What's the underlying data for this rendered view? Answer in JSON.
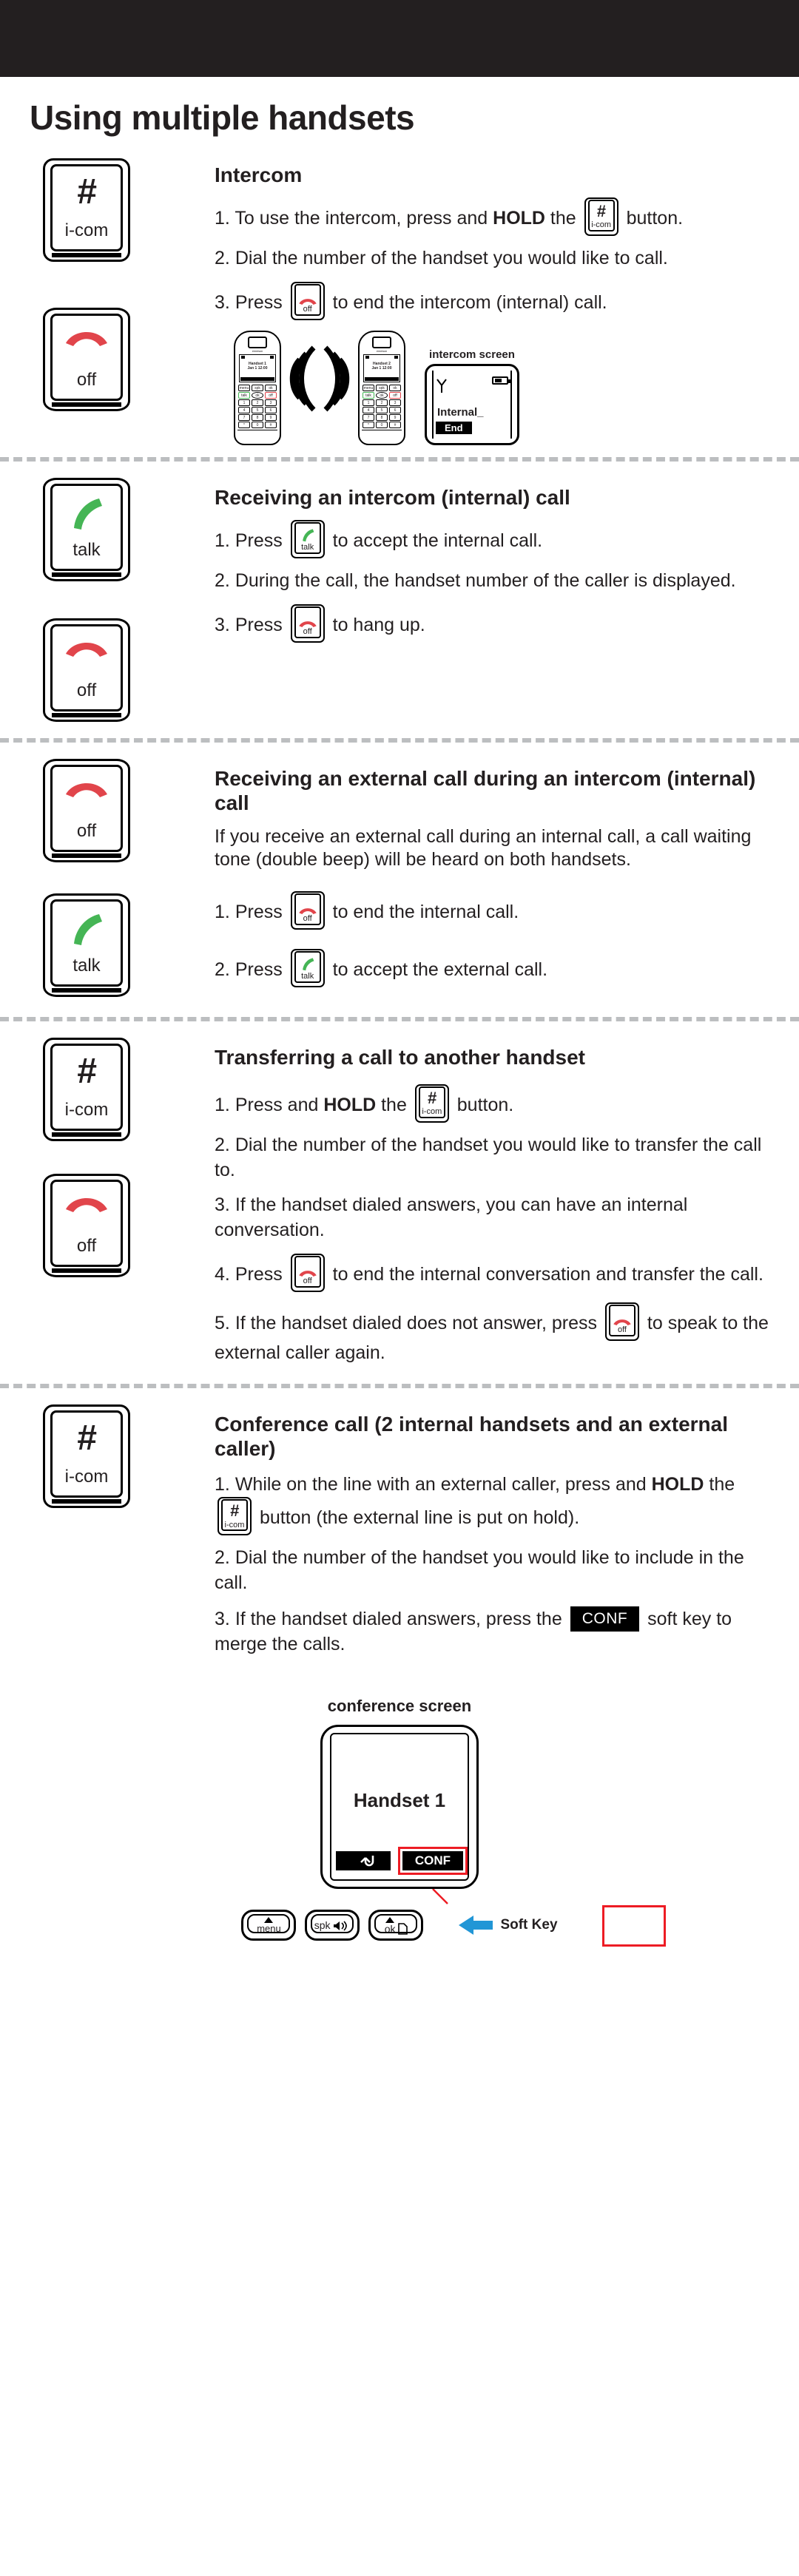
{
  "page_title": "Using multiple handsets",
  "keys": {
    "icom": {
      "glyph": "#",
      "label": "i-com",
      "name": "i-com-key"
    },
    "off": {
      "glyph": "",
      "label": "off",
      "name": "off-key"
    },
    "talk": {
      "glyph": "",
      "label": "talk",
      "name": "talk-key"
    }
  },
  "colors": {
    "header_bar": "#231f20",
    "off_hook_red": "#e1454b",
    "talk_green": "#45b555",
    "divider_grey": "#bcbec0",
    "highlight_red": "#ed1c24",
    "arrow_blue": "#2196d6",
    "text": "#231f20"
  },
  "sections": [
    {
      "id": "intercom",
      "title": "Intercom",
      "gutter_keys": [
        "icom",
        "off"
      ],
      "steps": [
        {
          "num": "1.",
          "parts": [
            {
              "t": "text",
              "v": "To use the intercom, press and "
            },
            {
              "t": "bold",
              "v": "HOLD"
            },
            {
              "t": "text",
              "v": " the "
            },
            {
              "t": "key",
              "v": "icom"
            },
            {
              "t": "text",
              "v": " button."
            }
          ]
        },
        {
          "num": "2.",
          "parts": [
            {
              "t": "text",
              "v": "Dial the number of the handset you would like to call."
            }
          ]
        },
        {
          "num": "3.",
          "parts": [
            {
              "t": "text",
              "v": "Press "
            },
            {
              "t": "key",
              "v": "off"
            },
            {
              "t": "text",
              "v": " to end the intercom (internal) call."
            }
          ]
        }
      ],
      "illustration": {
        "handsets": [
          {
            "line1": "Handset 1",
            "line2": "Jan 1 12:00",
            "keys": [
              "1",
              "2",
              "3",
              "4",
              "5",
              "6",
              "7",
              "8",
              "9",
              "*",
              "0",
              "#"
            ],
            "soft": [
              "menu",
              "spk",
              "ok"
            ]
          },
          {
            "line1": "Handset 2",
            "line2": "Jan 1 12:00",
            "keys": [
              "1",
              "2",
              "3",
              "4",
              "5",
              "6",
              "7",
              "8",
              "9",
              "*",
              "0",
              "#"
            ],
            "soft": [
              "menu",
              "spk",
              "ok"
            ]
          }
        ],
        "screen_caption": "intercom screen",
        "screen_text": "Internal_",
        "screen_softkey": "End"
      }
    },
    {
      "id": "receiving-intercom",
      "title": "Receiving an intercom (internal) call",
      "gutter_keys": [
        "talk",
        "off"
      ],
      "steps": [
        {
          "num": "1.",
          "parts": [
            {
              "t": "text",
              "v": "Press "
            },
            {
              "t": "key",
              "v": "talk"
            },
            {
              "t": "text",
              "v": " to accept the internal call."
            }
          ]
        },
        {
          "num": "2.",
          "parts": [
            {
              "t": "text",
              "v": "During the call, the handset number of the caller is displayed."
            }
          ]
        },
        {
          "num": "3.",
          "parts": [
            {
              "t": "text",
              "v": "Press "
            },
            {
              "t": "key",
              "v": "off"
            },
            {
              "t": "text",
              "v": " to hang up."
            }
          ]
        }
      ]
    },
    {
      "id": "receiving-external",
      "title": "Receiving an external call during an intercom (internal) call",
      "lead": "If you receive an external call during an internal call, a call waiting tone (double beep) will be heard on both handsets.",
      "gutter_keys": [
        "off",
        "talk"
      ],
      "steps": [
        {
          "num": "1.",
          "parts": [
            {
              "t": "text",
              "v": "Press "
            },
            {
              "t": "key",
              "v": "off"
            },
            {
              "t": "text",
              "v": " to end the internal call."
            }
          ]
        },
        {
          "num": "2.",
          "parts": [
            {
              "t": "text",
              "v": "Press "
            },
            {
              "t": "key",
              "v": "talk"
            },
            {
              "t": "text",
              "v": " to accept the external call."
            }
          ]
        }
      ]
    },
    {
      "id": "transferring",
      "title": "Transferring a call to another handset",
      "gutter_keys": [
        "icom",
        "off"
      ],
      "steps": [
        {
          "num": "1.",
          "parts": [
            {
              "t": "text",
              "v": "Press and "
            },
            {
              "t": "bold",
              "v": "HOLD"
            },
            {
              "t": "text",
              "v": " the "
            },
            {
              "t": "key",
              "v": "icom"
            },
            {
              "t": "text",
              "v": " button."
            }
          ]
        },
        {
          "num": "2.",
          "parts": [
            {
              "t": "text",
              "v": "Dial the number of the handset you would like to transfer the call to."
            }
          ]
        },
        {
          "num": "3.",
          "parts": [
            {
              "t": "text",
              "v": "If the handset dialed answers, you can have an internal conversation."
            }
          ]
        },
        {
          "num": "4.",
          "parts": [
            {
              "t": "text",
              "v": "Press "
            },
            {
              "t": "key",
              "v": "off"
            },
            {
              "t": "text",
              "v": " to end the internal conversation and transfer the call."
            }
          ]
        },
        {
          "num": "5.",
          "parts": [
            {
              "t": "text",
              "v": "If the handset dialed does not answer, press "
            },
            {
              "t": "key",
              "v": "off"
            },
            {
              "t": "text",
              "v": " to speak to the external caller again."
            }
          ]
        }
      ]
    },
    {
      "id": "conference",
      "title": "Conference call (2 internal handsets and an external caller)",
      "gutter_keys": [
        "icom"
      ],
      "steps": [
        {
          "num": "1.",
          "parts": [
            {
              "t": "text",
              "v": "While on the line with an external caller, press and "
            },
            {
              "t": "bold",
              "v": "HOLD"
            },
            {
              "t": "text",
              "v": " the "
            },
            {
              "t": "key",
              "v": "icom"
            },
            {
              "t": "text",
              "v": " button (the external line is put on hold)."
            }
          ]
        },
        {
          "num": "2.",
          "parts": [
            {
              "t": "text",
              "v": "Dial the number of the handset you would like to include in the call."
            }
          ]
        },
        {
          "num": "3.",
          "parts": [
            {
              "t": "text",
              "v": "If the handset dialed answers, press the "
            },
            {
              "t": "chip",
              "v": "CONF"
            },
            {
              "t": "text",
              "v": " soft key to merge the calls."
            }
          ]
        }
      ],
      "conference_illustration": {
        "caption": "conference screen",
        "display_title": "Handset 1",
        "softkey_left": "back-arrow",
        "softkey_right": "CONF",
        "buttons": [
          {
            "label": "menu",
            "icon": "up-triangle"
          },
          {
            "label": "spk",
            "icon": "speaker-icon"
          },
          {
            "label": "ok",
            "icon": "page-icon"
          }
        ],
        "callout": "Soft Key"
      }
    }
  ]
}
